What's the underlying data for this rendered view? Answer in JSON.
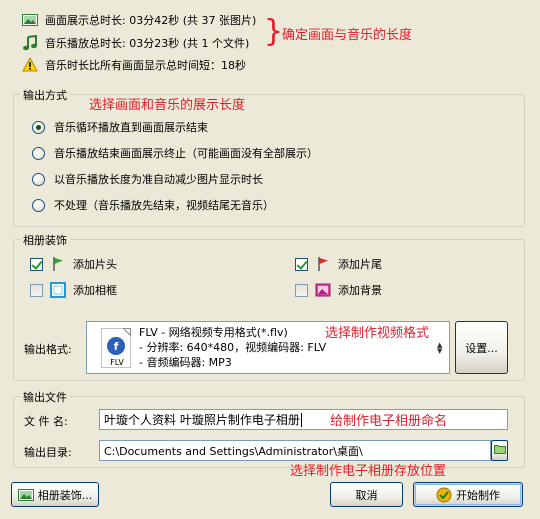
{
  "summary": {
    "image_duration": "画面展示总时长: 03分42秒 (共 37 张图片)",
    "music_duration": "音乐播放总时长: 03分23秒 (共 1 个文件)",
    "warning": "音乐时长比所有画面显示总时间短：18秒"
  },
  "annotations": {
    "brace": "}",
    "confirm_length": "确定画面与音乐的长度",
    "choose_length": "选择画面和音乐的展示长度",
    "choose_format": "选择制作视频格式",
    "name_album": "给制作电子相册命名",
    "choose_location": "选择制作电子相册存放位置"
  },
  "output_mode": {
    "title": "输出方式",
    "options": [
      {
        "label": "音乐循环播放直到画面展示结束",
        "checked": true
      },
      {
        "label": "音乐播放结束画面展示终止（可能画面没有全部展示）",
        "checked": false
      },
      {
        "label": "以音乐播放长度为准自动减少图片显示时长",
        "checked": false
      },
      {
        "label": "不处理（音乐播放先结束，视频结尾无音乐）",
        "checked": false
      }
    ]
  },
  "decoration": {
    "title": "相册装饰",
    "items": [
      {
        "label": "添加片头",
        "checked": true
      },
      {
        "label": "添加片尾",
        "checked": true
      },
      {
        "label": "添加相框",
        "checked": false
      },
      {
        "label": "添加背景",
        "checked": false
      }
    ],
    "format_label": "输出格式:",
    "format_icon_text": "FLV",
    "format_lines": [
      "FLV - 网络视频专用格式(*.flv)",
      "- 分辨率: 640*480，视频编码器: FLV",
      "- 音频编码器: MP3"
    ],
    "settings_button": "设置..."
  },
  "output_file": {
    "title": "输出文件",
    "filename_label": "文 件 名:",
    "filename_value": "叶璇个人资料 叶璇照片制作电子相册",
    "dir_label": "输出目录:",
    "dir_value": "C:\\Documents and Settings\\Administrator\\桌面\\"
  },
  "footer": {
    "album_decor_button": "相册装饰...",
    "cancel_button": "取消",
    "start_button": "开始制作"
  },
  "colors": {
    "background": "#ECE9D8",
    "annotation": "#E0202B",
    "button_border": "#003C74"
  }
}
